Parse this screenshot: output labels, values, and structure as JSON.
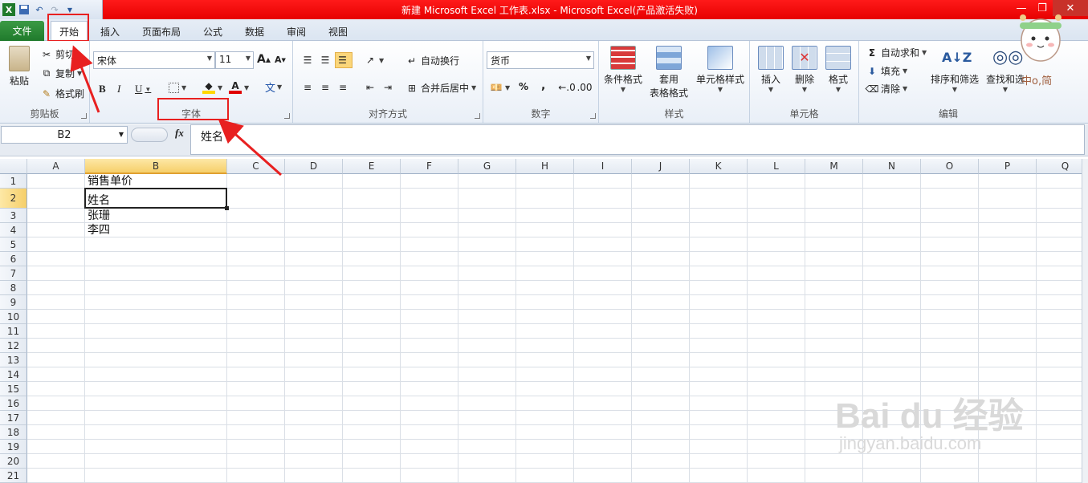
{
  "window": {
    "title": "新建 Microsoft Excel 工作表.xlsx - Microsoft Excel(产品激活失败)",
    "controls": {
      "minimize": "—",
      "restore": "❐",
      "close": "✕"
    }
  },
  "quick_access": {
    "app_icon": "X",
    "undo": "↶",
    "redo": "↷"
  },
  "tabs": [
    "文件",
    "开始",
    "插入",
    "页面布局",
    "公式",
    "数据",
    "审阅",
    "视图"
  ],
  "ribbon": {
    "clipboard": {
      "paste": "粘贴",
      "cut": "剪切",
      "copy": "复制",
      "format_painter": "格式刷",
      "label": "剪贴板"
    },
    "font": {
      "name": "宋体",
      "size": "11",
      "bold": "B",
      "italic": "I",
      "underline": "U",
      "grow": "A",
      "shrink": "A",
      "wen": "文",
      "label": "字体"
    },
    "alignment": {
      "wrap": "自动换行",
      "merge": "合并后居中",
      "label": "对齐方式"
    },
    "number": {
      "format": "货币",
      "percent": "%",
      "comma": ",",
      "label": "数字"
    },
    "styles": {
      "cond": "条件格式",
      "table_a": "套用",
      "table_b": "表格格式",
      "cell_style": "单元格样式",
      "label": "样式"
    },
    "cells": {
      "insert": "插入",
      "delete": "删除",
      "format": "格式",
      "label": "单元格"
    },
    "editing": {
      "autosum": "自动求和",
      "fill": "填充",
      "clear": "清除",
      "sort": "排序和筛选",
      "find": "查找和选",
      "label": "编辑"
    }
  },
  "formula_bar": {
    "name_box": "B2",
    "fx": "fx",
    "content": "姓名"
  },
  "sheet": {
    "columns": [
      "A",
      "B",
      "C",
      "D",
      "E",
      "F",
      "G",
      "H",
      "I",
      "J",
      "K",
      "L",
      "M",
      "N",
      "O",
      "P",
      "Q"
    ],
    "rows": [
      "1",
      "2",
      "3",
      "4",
      "5",
      "6",
      "7",
      "8",
      "9",
      "10",
      "11",
      "12",
      "13",
      "14",
      "15",
      "16",
      "17",
      "18",
      "19",
      "20",
      "21"
    ],
    "cells": {
      "B1": "销售单价",
      "B2": "姓名",
      "B3": "张珊",
      "B4": "李四"
    },
    "selected": "B2"
  },
  "watermark": {
    "logo": "Bai du 经验",
    "url": "jingyan.baidu.com",
    "mascot_text": "中o,简"
  },
  "accent": {
    "red": "#e82020",
    "title_red": "#e60000",
    "file_green": "#1f7a2c"
  }
}
